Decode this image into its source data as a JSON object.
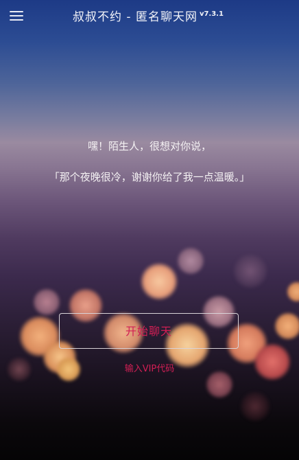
{
  "header": {
    "menu_icon": "hamburger-menu-icon",
    "title": "叔叔不约 - 匿名聊天网",
    "version": "v7.3.1"
  },
  "greeting": {
    "line1": "嘿！陌生人，很想对你说，",
    "line2": "「那个夜晚很冷，谢谢你给了我一点温暖。」"
  },
  "actions": {
    "start_chat_label": "开始聊天",
    "vip_code_label": "输入VIP代码"
  },
  "colors": {
    "accent": "#d21f55",
    "text_light": "#f4f1f3"
  }
}
